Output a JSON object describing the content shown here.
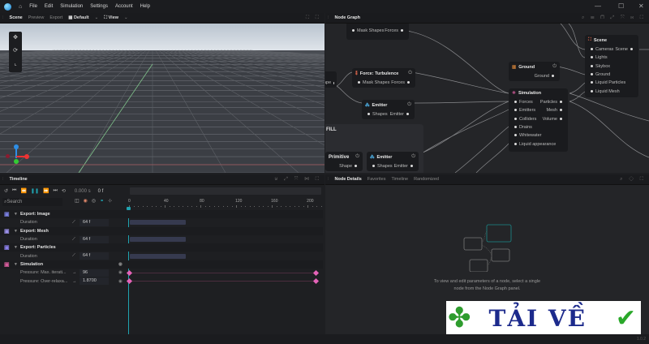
{
  "menubar": {
    "items": [
      "File",
      "Edit",
      "Simulation",
      "Settings",
      "Account",
      "Help"
    ],
    "window_controls": [
      "—",
      "☐",
      "✕"
    ]
  },
  "scene_panel": {
    "tabs": [
      "Scene",
      "Preview",
      "Export"
    ],
    "layout_select": "Default",
    "view_select": "View"
  },
  "node_graph": {
    "title": "Node Graph",
    "nodes": {
      "top_partial": {
        "inputs": [
          "Mask Shapes"
        ],
        "outputs": [
          "Forces"
        ]
      },
      "turbulence": {
        "title": "Force: Turbulence",
        "inputs": [
          "Mask Shapes"
        ],
        "outputs": [
          "Forces"
        ]
      },
      "left_partial": {
        "outputs": [
          "ape"
        ]
      },
      "emitter1": {
        "title": "Emitter",
        "inputs": [
          "Shapes"
        ],
        "outputs": [
          "Emitter"
        ]
      },
      "fill_group": {
        "title": "FILL"
      },
      "primitive": {
        "title": "Primitive",
        "outputs": [
          "Shape"
        ]
      },
      "emitter2": {
        "title": "Emitter",
        "inputs": [
          "Shapes"
        ],
        "outputs": [
          "Emitter"
        ]
      },
      "ground": {
        "title": "Ground",
        "outputs": [
          "Ground"
        ]
      },
      "simulation": {
        "title": "Simulation",
        "inputs": [
          "Forces",
          "Emitters",
          "Colliders",
          "Drains",
          "Whitewater",
          "Liquid appearance"
        ],
        "outputs": [
          "Particles",
          "Mesh",
          "Volume"
        ]
      },
      "scene": {
        "title": "Scene",
        "inputs": [
          "Cameras",
          "Lights",
          "Skybox",
          "Ground",
          "Liquid Particles",
          "Liquid Mesh"
        ],
        "outputs": [
          "Scene"
        ]
      }
    }
  },
  "timeline": {
    "title": "Timeline",
    "time": "0.000",
    "time_unit": "s",
    "frame": "0 f",
    "search_placeholder": "Search",
    "ruler": [
      "0",
      "40",
      "80",
      "120",
      "160",
      "200"
    ],
    "rows": [
      {
        "type": "group",
        "label": "Export: Image"
      },
      {
        "type": "param",
        "label": "Duration",
        "value": "64 f"
      },
      {
        "type": "group",
        "label": "Export: Mesh"
      },
      {
        "type": "param",
        "label": "Duration",
        "value": "64 f"
      },
      {
        "type": "group",
        "label": "Export: Particles"
      },
      {
        "type": "param",
        "label": "Duration",
        "value": "64 f"
      },
      {
        "type": "group",
        "label": "Simulation"
      },
      {
        "type": "param",
        "label": "Pressure: Max. iterati...",
        "value": "96"
      },
      {
        "type": "param",
        "label": "Pressure: Over-relaxa...",
        "value": "1.8700"
      }
    ]
  },
  "node_details": {
    "tabs": [
      "Node Details",
      "Favorites",
      "Timeline",
      "Randomized"
    ],
    "empty_message_line1": "To view and edit parameters of a node, select a single",
    "empty_message_line2": "node from the Node Graph panel."
  },
  "watermark": {
    "text": "TẢI VỀ"
  },
  "status": {
    "version": "1.0.2"
  },
  "colors": {
    "accent": "#1fa3b0",
    "keyframe": "#e563b8",
    "bg": "#1e1f22"
  }
}
